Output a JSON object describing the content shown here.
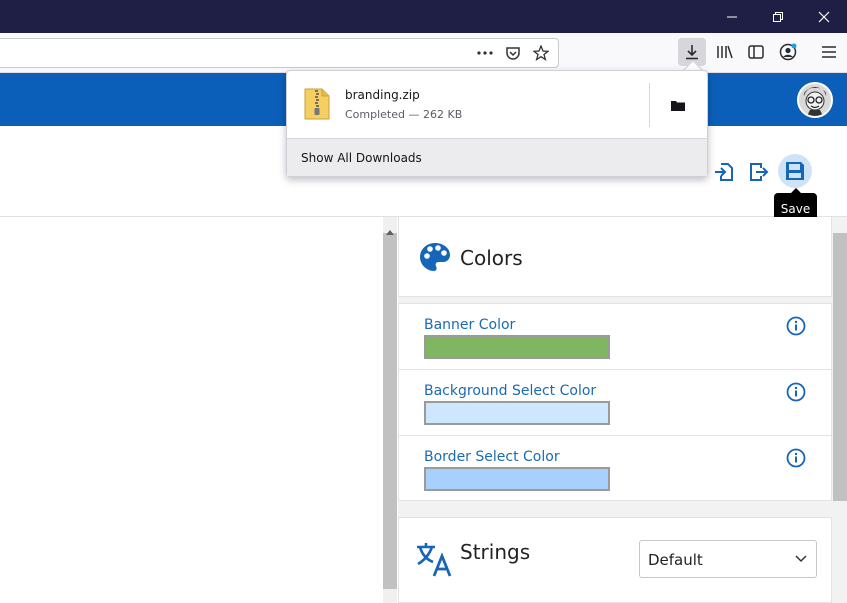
{
  "downloads": {
    "file_name": "branding.zip",
    "status": "Completed — 262 KB",
    "show_all": "Show All Downloads"
  },
  "tooltip": {
    "save": "Save"
  },
  "colors_section": {
    "title": "Colors",
    "fields": [
      {
        "label": "Banner Color",
        "color": "#80b562"
      },
      {
        "label": "Background Select Color",
        "color": "#cfe6ff"
      },
      {
        "label": "Border Select Color",
        "color": "#a8d0ff"
      }
    ]
  },
  "strings_section": {
    "title": "Strings",
    "select_value": "Default"
  },
  "theme": {
    "brand_blue": "#0b5fb8",
    "icon_blue": "#1565b8",
    "titlebar": "#1f1f45"
  }
}
